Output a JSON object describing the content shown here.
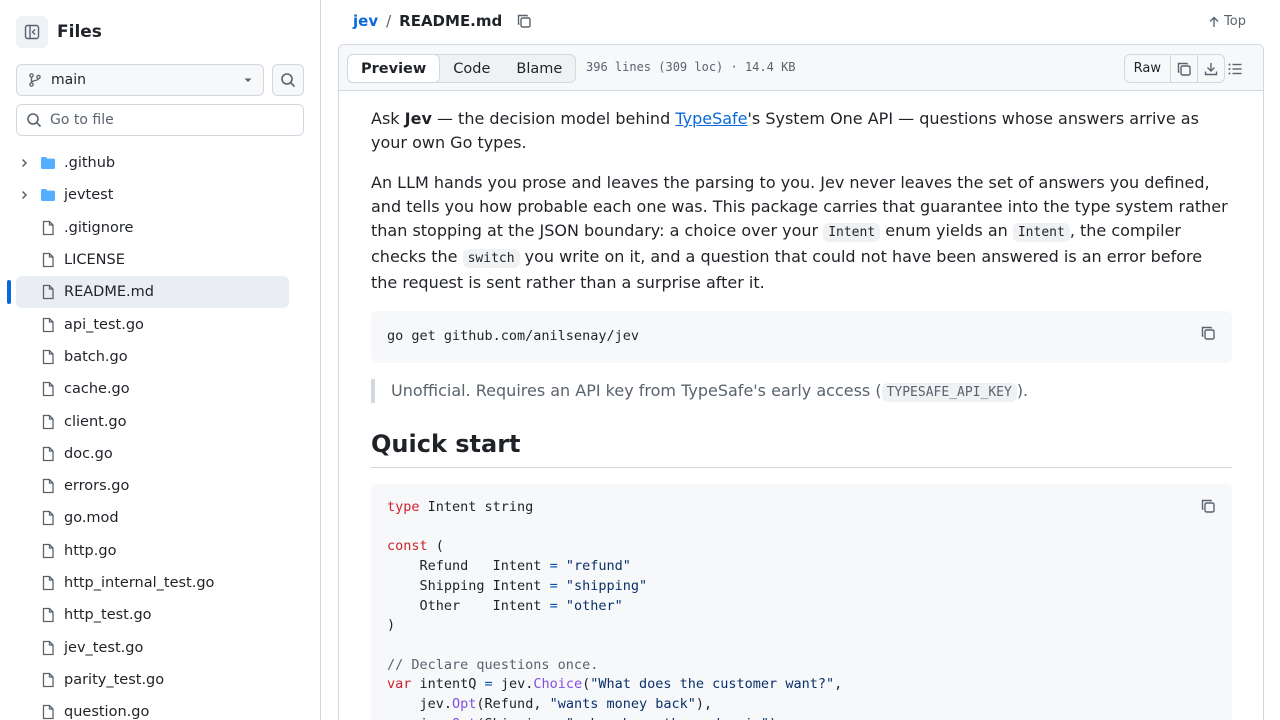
{
  "sidebar": {
    "title": "Files",
    "branch": "main",
    "goto_placeholder": "Go to file",
    "items": [
      {
        "name": ".github",
        "type": "dir"
      },
      {
        "name": "jevtest",
        "type": "dir"
      },
      {
        "name": ".gitignore",
        "type": "file"
      },
      {
        "name": "LICENSE",
        "type": "file"
      },
      {
        "name": "README.md",
        "type": "file",
        "active": true
      },
      {
        "name": "api_test.go",
        "type": "file"
      },
      {
        "name": "batch.go",
        "type": "file"
      },
      {
        "name": "cache.go",
        "type": "file"
      },
      {
        "name": "client.go",
        "type": "file"
      },
      {
        "name": "doc.go",
        "type": "file"
      },
      {
        "name": "errors.go",
        "type": "file"
      },
      {
        "name": "go.mod",
        "type": "file"
      },
      {
        "name": "http.go",
        "type": "file"
      },
      {
        "name": "http_internal_test.go",
        "type": "file"
      },
      {
        "name": "http_test.go",
        "type": "file"
      },
      {
        "name": "jev_test.go",
        "type": "file"
      },
      {
        "name": "parity_test.go",
        "type": "file"
      },
      {
        "name": "question.go",
        "type": "file"
      }
    ]
  },
  "header": {
    "repo": "jev",
    "separator": "/",
    "file": "README.md",
    "top_label": "Top"
  },
  "filebar": {
    "tabs": [
      "Preview",
      "Code",
      "Blame"
    ],
    "selected_tab": "Preview",
    "meta": "396 lines (309 loc) · 14.4 KB",
    "raw_label": "Raw"
  },
  "readme": {
    "p1": {
      "a": "Ask ",
      "b": "Jev",
      "c": " — the decision model behind ",
      "link": "TypeSafe",
      "d": "'s System One API — questions whose answers arrive as your own Go types."
    },
    "p2": {
      "a": "An LLM hands you prose and leaves the parsing to you. Jev never leaves the set of answers you defined, and tells you how probable each one was. This package carries that guarantee into the type system rather than stopping at the JSON boundary: a choice over your ",
      "code1": "Intent",
      "b": " enum yields an ",
      "code2": "Intent",
      "c": ", the compiler checks the ",
      "code3": "switch",
      "d": " you write on it, and a question that could not have been answered is an error before the request is sent rather than a surprise after it."
    },
    "install_cmd": "go get github.com/anilsenay/jev",
    "note": {
      "a": "Unofficial. Requires an API key from TypeSafe's early access (",
      "code": "TYPESAFE_API_KEY",
      "b": ")."
    },
    "quickstart_heading": "Quick start",
    "code_lines": [
      [
        {
          "t": "type",
          "c": "kw"
        },
        {
          "t": " Intent string",
          "c": ""
        }
      ],
      [],
      [
        {
          "t": "const",
          "c": "kw"
        },
        {
          "t": " (",
          "c": ""
        }
      ],
      [
        {
          "t": "    Refund   Intent ",
          "c": ""
        },
        {
          "t": "=",
          "c": "op"
        },
        {
          "t": " ",
          "c": ""
        },
        {
          "t": "\"refund\"",
          "c": "str"
        }
      ],
      [
        {
          "t": "    Shipping Intent ",
          "c": ""
        },
        {
          "t": "=",
          "c": "op"
        },
        {
          "t": " ",
          "c": ""
        },
        {
          "t": "\"shipping\"",
          "c": "str"
        }
      ],
      [
        {
          "t": "    Other    Intent ",
          "c": ""
        },
        {
          "t": "=",
          "c": "op"
        },
        {
          "t": " ",
          "c": ""
        },
        {
          "t": "\"other\"",
          "c": "str"
        }
      ],
      [
        {
          "t": ")",
          "c": ""
        }
      ],
      [],
      [
        {
          "t": "// Declare questions once.",
          "c": "cm"
        }
      ],
      [
        {
          "t": "var",
          "c": "kw"
        },
        {
          "t": " intentQ ",
          "c": ""
        },
        {
          "t": "=",
          "c": "op"
        },
        {
          "t": " jev.",
          "c": ""
        },
        {
          "t": "Choice",
          "c": "fn"
        },
        {
          "t": "(",
          "c": ""
        },
        {
          "t": "\"What does the customer want?\"",
          "c": "str"
        },
        {
          "t": ",",
          "c": ""
        }
      ],
      [
        {
          "t": "    jev.",
          "c": ""
        },
        {
          "t": "Opt",
          "c": "fn"
        },
        {
          "t": "(Refund, ",
          "c": ""
        },
        {
          "t": "\"wants money back\"",
          "c": "str"
        },
        {
          "t": "),",
          "c": ""
        }
      ],
      [
        {
          "t": "    jev.",
          "c": ""
        },
        {
          "t": "Opt",
          "c": "fn"
        },
        {
          "t": "(Shipping, ",
          "c": ""
        },
        {
          "t": "\"asks where the order is\"",
          "c": "str"
        },
        {
          "t": "),",
          "c": ""
        }
      ]
    ]
  }
}
